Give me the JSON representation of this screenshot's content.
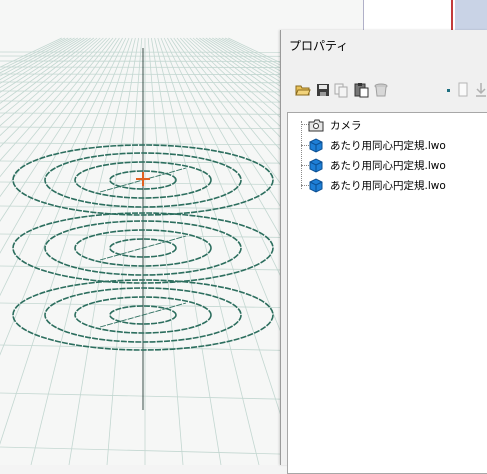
{
  "panel": {
    "title": "プロパティ",
    "toolbar_icons": [
      "open-folder-icon",
      "save-icon",
      "copy-icon",
      "paste-icon",
      "delete-icon",
      "dot-icon",
      "new-page-icon",
      "download-icon"
    ]
  },
  "tree": {
    "items": [
      {
        "label": "カメラ",
        "icon": "camera-folder-icon"
      },
      {
        "label": "あたり用同心円定規.lwo",
        "icon": "cube-icon"
      },
      {
        "label": "あたり用同心円定規.lwo",
        "icon": "cube-icon"
      },
      {
        "label": "あたり用同心円定規.lwo",
        "icon": "cube-icon"
      }
    ]
  },
  "colors": {
    "grid": "#c3d7d1",
    "rings": "#2c6e5e",
    "cursor": "#e0601f",
    "cube": "#1e7fd6"
  }
}
